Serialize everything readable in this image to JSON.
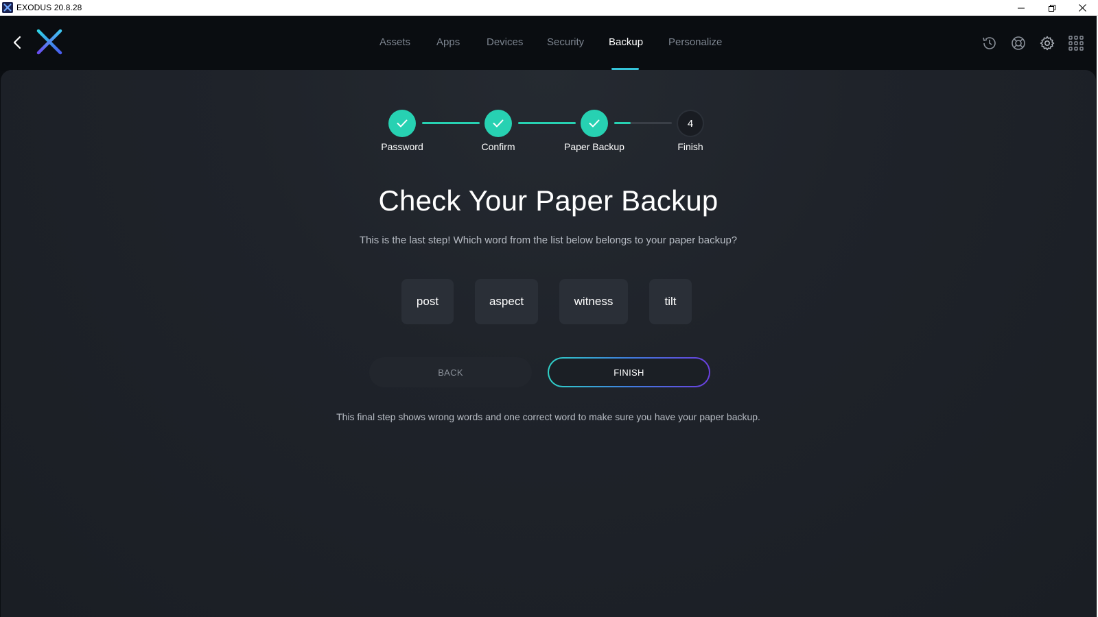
{
  "window": {
    "title": "EXODUS 20.8.28"
  },
  "nav": {
    "tabs": [
      {
        "label": "Assets"
      },
      {
        "label": "Apps"
      },
      {
        "label": "Devices"
      },
      {
        "label": "Security"
      },
      {
        "label": "Backup"
      },
      {
        "label": "Personalize"
      }
    ],
    "active_tab": "Backup",
    "right_icons": [
      "history-icon",
      "support-icon",
      "settings-icon",
      "apps-grid-icon"
    ]
  },
  "stepper": {
    "steps": [
      {
        "label": "Password",
        "state": "done"
      },
      {
        "label": "Confirm",
        "state": "done"
      },
      {
        "label": "Paper Backup",
        "state": "done"
      },
      {
        "label": "Finish",
        "state": "pending",
        "number": "4"
      }
    ]
  },
  "main": {
    "heading": "Check Your Paper Backup",
    "subtext": "This is the last step! Which word from the list below belongs to your paper backup?",
    "words": [
      "post",
      "aspect",
      "witness",
      "tilt"
    ],
    "back_label": "BACK",
    "finish_label": "FINISH",
    "footnote": "This final step shows wrong words and one correct word to make sure you have your paper backup."
  },
  "colors": {
    "accent_teal": "#27d1b2",
    "tab_underline": "#35c3d8",
    "background": "#1f232a",
    "word_button": "#2a2f37"
  }
}
